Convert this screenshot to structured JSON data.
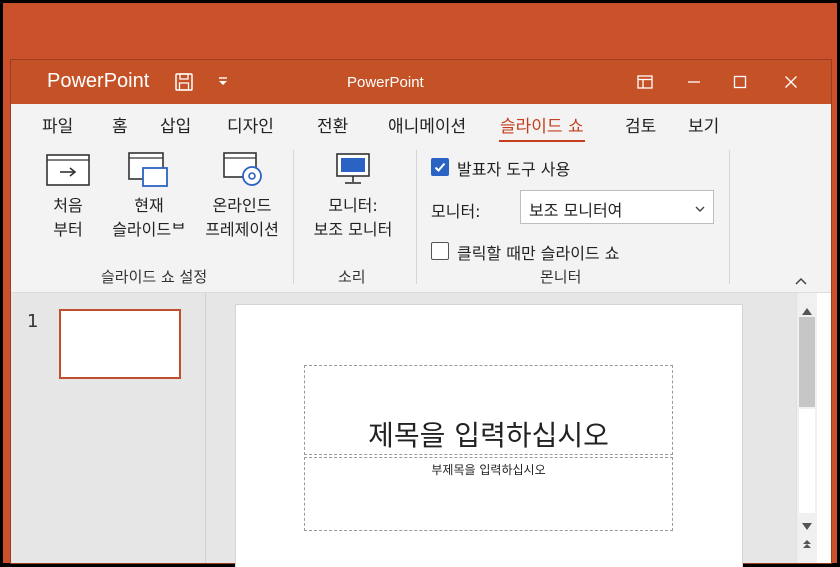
{
  "titlebar": {
    "app_name": "PowerPoint",
    "doc_title": "PowerPoint",
    "color": "#c55127"
  },
  "icons": {
    "save": "floppy-save-icon",
    "quick_access": "customize-quick-access-icon",
    "ribbon_display": "ribbon-display-options-icon",
    "minimize": "minimize-icon",
    "maximize": "maximize-icon",
    "close": "close-icon"
  },
  "tabs": [
    {
      "label": "파일"
    },
    {
      "label": "홈"
    },
    {
      "label": "삽입"
    },
    {
      "label": "디자인"
    },
    {
      "label": "전환"
    },
    {
      "label": "애니메이션"
    },
    {
      "label": "슬라이드 쇼",
      "active": true
    },
    {
      "label": "검토"
    },
    {
      "label": "보기"
    }
  ],
  "ribbon": {
    "start_from_beginning": {
      "line1": "처음",
      "line2": "부터"
    },
    "from_current": {
      "line1": "현재",
      "line2": "슬라이드ᄇ"
    },
    "present_online": {
      "line1": "온라인드",
      "line2": "프레제이션"
    },
    "group_setup": "슬라이드 쇼 설정",
    "monitor_btn": {
      "line1": "모니터:",
      "line2": "보조 모니터"
    },
    "group_sound": "소리",
    "presenter_view": {
      "label": "발표자 도구 사용",
      "checked": true
    },
    "monitor_label": "모니터:",
    "monitor_select": "보조 모니터여",
    "click_only": {
      "label": "클릭할 때만 슬라이드 쇼",
      "checked": false
    },
    "group_monitors": "몬니터"
  },
  "slides_pane": {
    "slide_number": "1"
  },
  "slide": {
    "title_placeholder": "제목을 입력하십시오",
    "subtitle_placeholder": "부제목을 입력하십시오"
  },
  "colors": {
    "accent": "#c43e1c",
    "desktop": "#cb512c",
    "checkbox": "#2b63c4"
  }
}
